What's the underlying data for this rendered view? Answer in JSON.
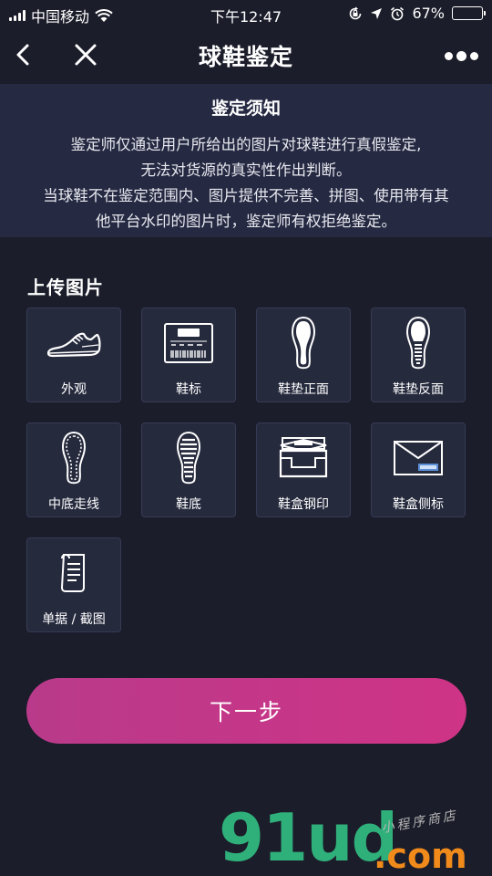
{
  "status_bar": {
    "carrier": "中国移动",
    "time": "下午12:47",
    "battery_percent_text": "67%",
    "battery_level": 0.67
  },
  "nav": {
    "title": "球鞋鉴定"
  },
  "notice": {
    "title": "鉴定须知",
    "lines": [
      "鉴定师仅通过用户所给出的图片对球鞋进行真假鉴定,",
      "无法对货源的真实性作出判断。",
      "当球鞋不在鉴定范围内、图片提供不完善、拼图、使用带有其",
      "他平台水印的图片时，鉴定师有权拒绝鉴定。"
    ]
  },
  "upload": {
    "title": "上传图片",
    "items": [
      {
        "label": "外观",
        "icon": "sneaker-icon"
      },
      {
        "label": "鞋标",
        "icon": "shoe-tag-icon"
      },
      {
        "label": "鞋垫正面",
        "icon": "insole-front-icon"
      },
      {
        "label": "鞋垫反面",
        "icon": "insole-back-icon"
      },
      {
        "label": "中底走线",
        "icon": "midsole-stitch-icon"
      },
      {
        "label": "鞋底",
        "icon": "outsole-icon"
      },
      {
        "label": "鞋盒钢印",
        "icon": "shoebox-icon"
      },
      {
        "label": "鞋盒侧标",
        "icon": "box-side-label-icon"
      },
      {
        "label": "单据 / 截图",
        "icon": "receipt-icon"
      }
    ]
  },
  "next_button": {
    "label": "下一步"
  },
  "watermark": {
    "logo": "91ud",
    "domain": ".com",
    "tagline": "小程序商店"
  }
}
